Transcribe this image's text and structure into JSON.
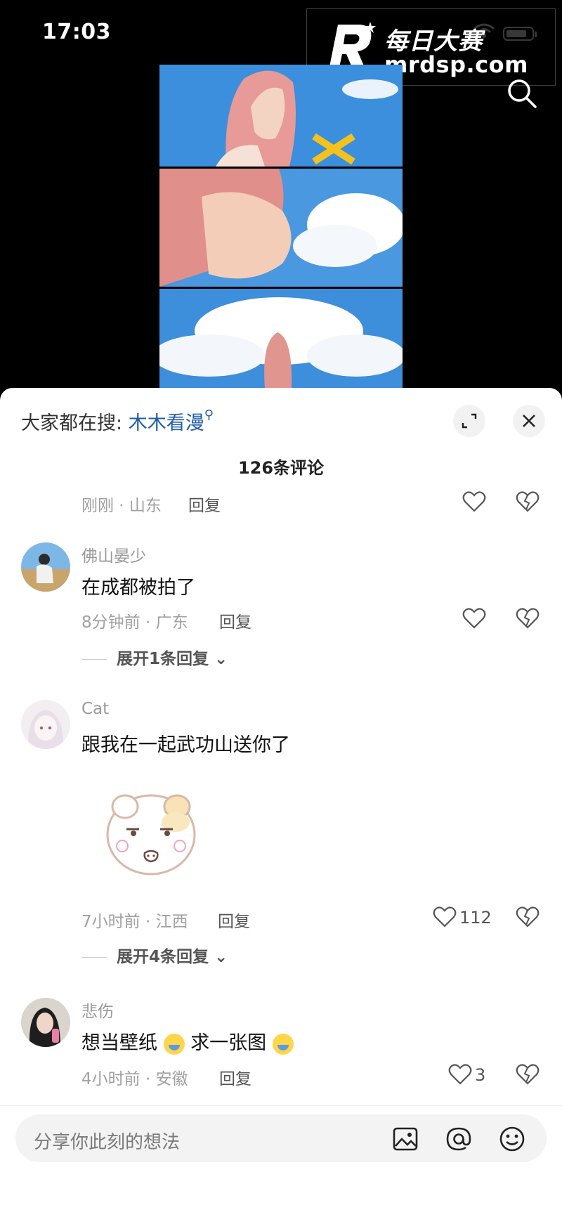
{
  "status": {
    "time": "17:03"
  },
  "watermark": {
    "title": "每日大赛",
    "url": "mrdsp.com"
  },
  "comments_panel": {
    "hot_search_prefix": "大家都在搜:",
    "hot_search_keyword": "木木看漫",
    "count": "126条评论",
    "partial_row": {
      "meta": "刚刚 · 山东",
      "reply": "回复"
    },
    "comments": [
      {
        "user": "佛山晏少",
        "text": "在成都被拍了",
        "meta": "8分钟前 · 广东",
        "reply": "回复",
        "expand": "展开1条回复"
      },
      {
        "user": "Cat",
        "text": "跟我在一起武功山送你了",
        "meta": "7小时前 · 江西",
        "reply": "回复",
        "likes": "112",
        "expand": "展开4条回复"
      },
      {
        "user": "悲伤",
        "text_a": "想当壁纸",
        "text_b": "求一张图",
        "meta": "4小时前 · 安徽",
        "reply": "回复",
        "likes": "3"
      }
    ]
  },
  "input": {
    "placeholder": "分享你此刻的想法"
  }
}
